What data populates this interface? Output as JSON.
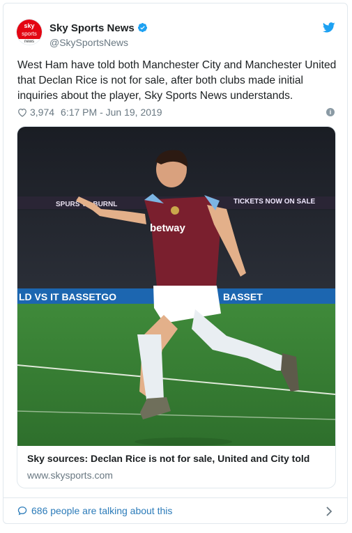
{
  "account": {
    "avatar_lines": [
      "sky",
      "sports",
      "news"
    ],
    "name": "Sky Sports News",
    "handle": "@SkySportsNews"
  },
  "tweet": {
    "text": "West Ham have told both Manchester City and Manchester United that Declan Rice is not for sale, after both clubs made initial inquiries about the player, Sky Sports News understands.",
    "likes": "3,974",
    "timestamp": "6:17 PM - Jun 19, 2019"
  },
  "card": {
    "photo_text": {
      "ad_board_top_left": "SPURS VS BURNL",
      "ad_board_top_right": "TICKETS NOW ON SALE",
      "ad_board_bottom": "LD VS IT BASSETGO",
      "ad_board_bottom_right": "BASSET",
      "shirt_sponsor": "betway"
    },
    "title": "Sky sources: Declan Rice is not for sale, United and City told",
    "url": "www.skysports.com"
  },
  "footer": {
    "talking_text": "686 people are talking about this"
  },
  "colors": {
    "link_blue": "#2b7bb9",
    "twitter_blue": "#1da1f2",
    "verified_blue": "#1da1f2",
    "sky_red": "#e30613",
    "muted_text": "#697882"
  },
  "icons": [
    "verified-badge-icon",
    "twitter-bird-icon",
    "heart-icon",
    "info-icon",
    "speech-bubble-icon",
    "chevron-right-icon"
  ]
}
